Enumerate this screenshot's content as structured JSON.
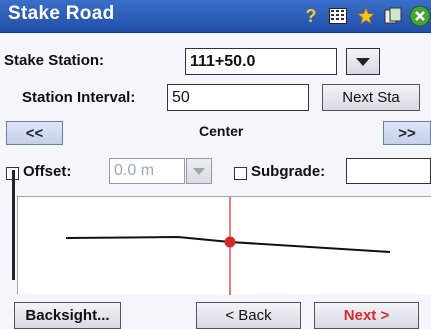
{
  "window": {
    "title": "Stake Road"
  },
  "toolbar_icons": [
    "help-icon",
    "keypad-icon",
    "favorites-icon",
    "copy-icon",
    "close-icon"
  ],
  "form": {
    "stake_station_label": "Stake Station:",
    "stake_station_value": "111+50.0",
    "station_interval_label": "Station Interval:",
    "station_interval_value": "50",
    "next_sta_label": "Next Sta",
    "prev_label": "<<",
    "center_label": "Center",
    "next_nav_label": ">>",
    "offset_label": "Offset:",
    "offset_value": "0.0 m",
    "subgrade_label": "Subgrade:",
    "subgrade_value": ""
  },
  "footer": {
    "backsight_label": "Backsight...",
    "back_label": "< Back",
    "next_label": "Next >"
  },
  "colors": {
    "title_bar": "#1f4fa8",
    "next_text": "#d8282a",
    "station_marker": "#d8282a"
  }
}
